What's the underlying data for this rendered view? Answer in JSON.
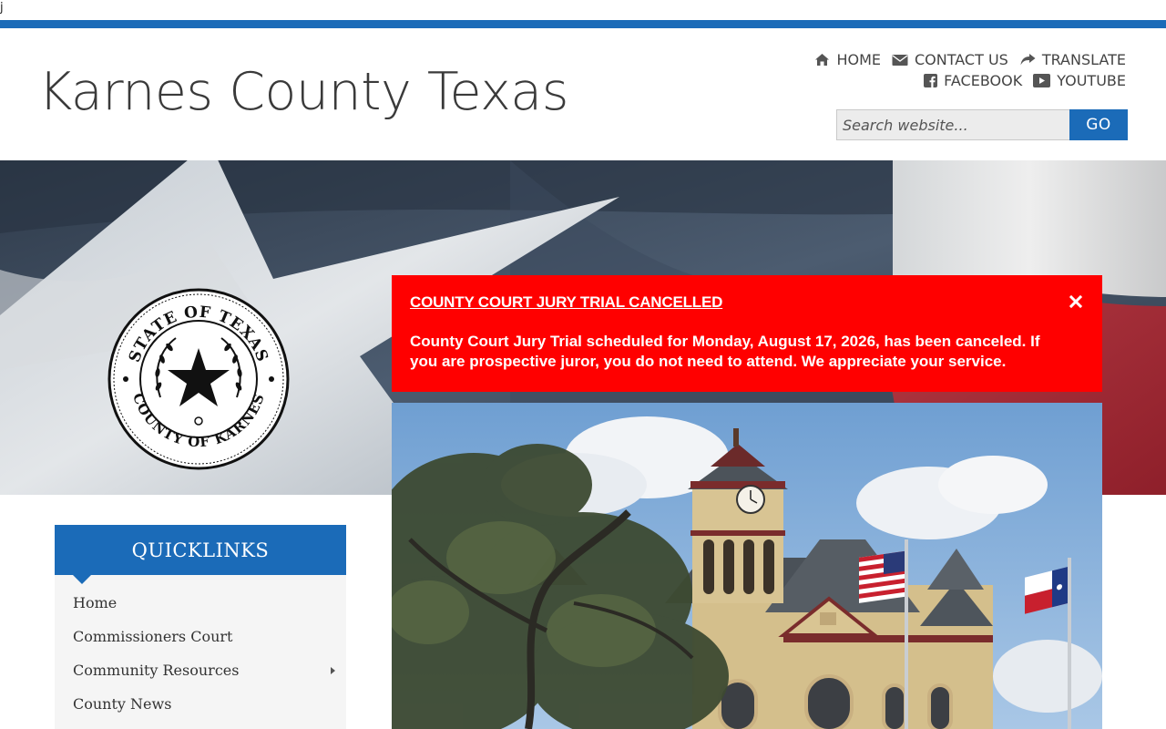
{
  "stray": {
    "text": "j"
  },
  "header": {
    "site_title": "Karnes County Texas"
  },
  "utility_nav": {
    "row1": [
      {
        "label": "HOME",
        "icon": "home-icon"
      },
      {
        "label": "CONTACT US",
        "icon": "envelope-icon"
      },
      {
        "label": "TRANSLATE",
        "icon": "share-arrow-icon"
      }
    ],
    "row2": [
      {
        "label": "FACEBOOK",
        "icon": "facebook-icon"
      },
      {
        "label": "YOUTUBE",
        "icon": "youtube-icon"
      }
    ]
  },
  "search": {
    "placeholder": "Search website...",
    "button_label": "GO"
  },
  "seal": {
    "top_text": "STATE OF TEXAS",
    "bottom_text": "COUNTY OF KARNES"
  },
  "alert": {
    "title": "COUNTY COURT JURY TRIAL CANCELLED",
    "body": "County Court Jury Trial scheduled for Monday, August 17, 2026, has been canceled. If you are prospective juror, you do not need to attend. We appreciate your service."
  },
  "quicklinks": {
    "heading": "QUICKLINKS",
    "items": [
      {
        "label": "Home",
        "has_submenu": false
      },
      {
        "label": "Commissioners Court",
        "has_submenu": false
      },
      {
        "label": "Community Resources",
        "has_submenu": true
      },
      {
        "label": "County News",
        "has_submenu": false
      }
    ]
  },
  "colors": {
    "brand_blue": "#1b6bb8",
    "alert_red": "#ff0000"
  }
}
